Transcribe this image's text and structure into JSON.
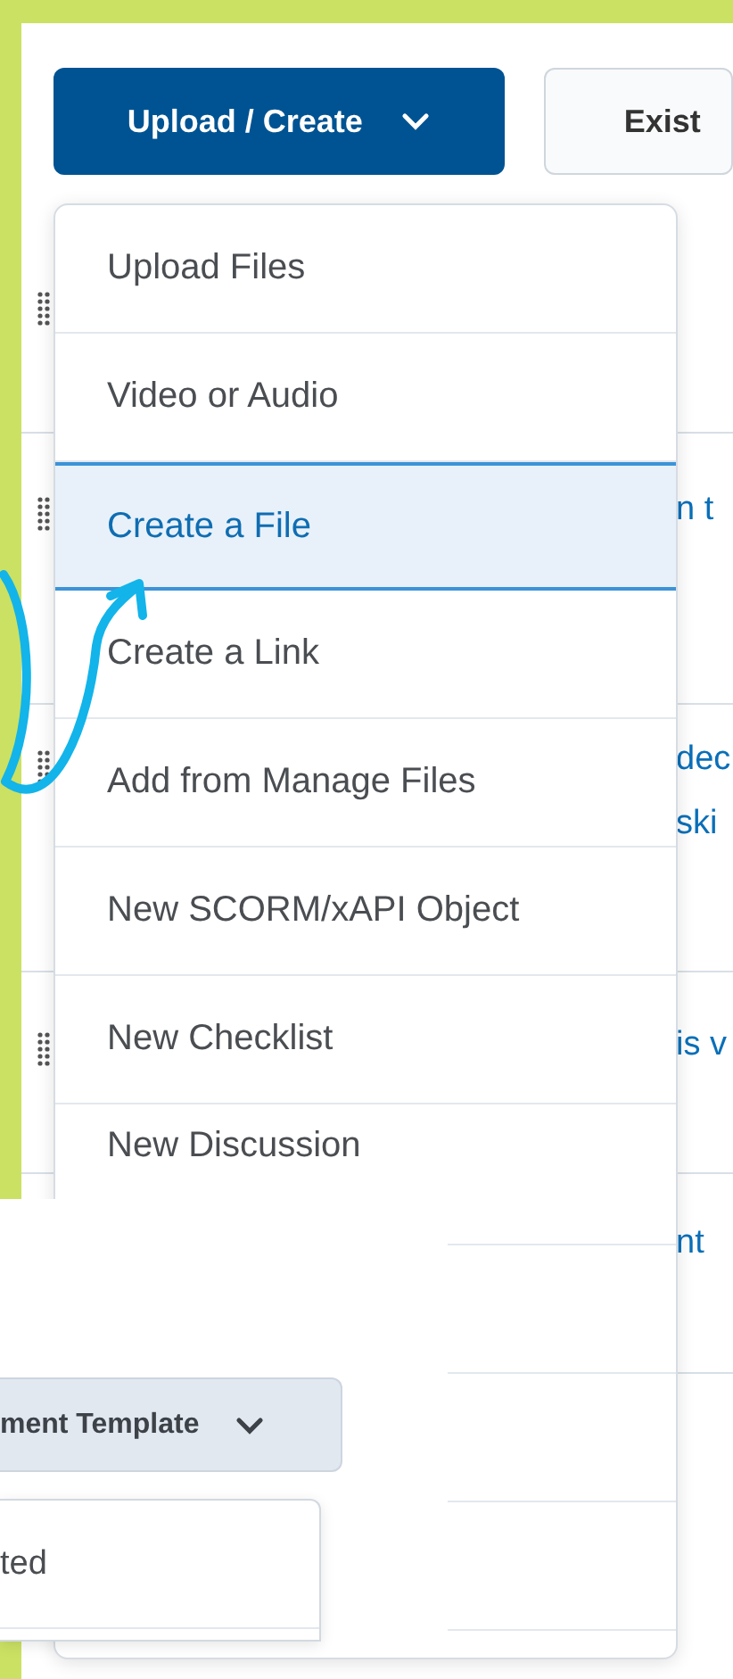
{
  "toolbar": {
    "buttons": [
      {
        "label": "Upload / Create",
        "kind": "primary",
        "caret": true
      },
      {
        "label": "Exist",
        "kind": "secondary",
        "caret": false
      }
    ]
  },
  "content_rows": [
    {
      "lines": []
    },
    {
      "lines": [
        "n t"
      ]
    },
    {
      "lines": [
        "dec",
        "ski"
      ]
    },
    {
      "lines": [
        "is v"
      ]
    },
    {
      "lines": [
        "nt"
      ]
    }
  ],
  "upload_menu": {
    "items": [
      {
        "label": "Upload Files",
        "selected": false
      },
      {
        "label": "Video or Audio",
        "selected": false
      },
      {
        "label": "Create a File",
        "selected": true
      },
      {
        "label": "Create a Link",
        "selected": false
      },
      {
        "label": "Add from Manage Files",
        "selected": false
      },
      {
        "label": "New SCORM/xAPI Object",
        "selected": false
      },
      {
        "label": "New Checklist",
        "selected": false
      },
      {
        "label": "New Discussion",
        "selected": false
      }
    ]
  },
  "inset": {
    "template_button": {
      "label": "ment Template"
    },
    "menu_items": [
      {
        "label": "ted"
      }
    ]
  }
}
